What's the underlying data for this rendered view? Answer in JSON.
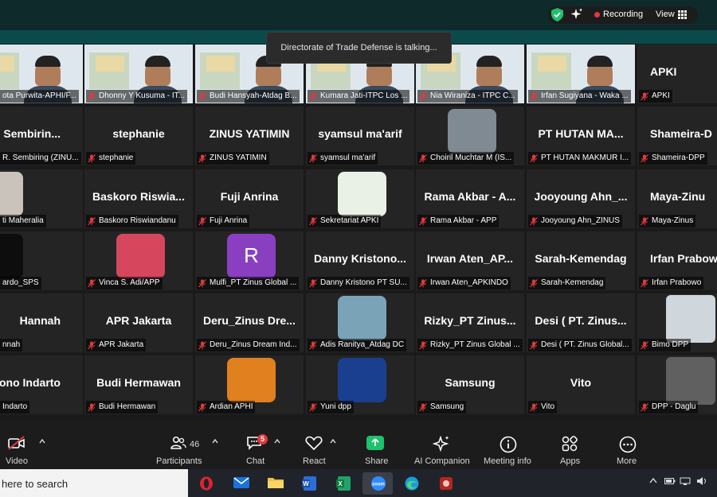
{
  "topbar": {
    "recording_label": "Recording",
    "view_label": "View",
    "icons": [
      "security-shield-icon",
      "ai-sparkle-icon",
      "recording-dot-icon",
      "grid-view-icon"
    ]
  },
  "toast": {
    "text": "Directorate of Trade Defense is talking..."
  },
  "participants": [
    {
      "label": "ota Purwita-APHI/F...",
      "big": ""
    },
    {
      "label": "Dhonny Y Kusuma - IT...",
      "big": ""
    },
    {
      "label": "Budi Hansyah-Atdag B...",
      "big": ""
    },
    {
      "label": "Kumara Jati-ITPC Los ...",
      "big": ""
    },
    {
      "label": "Nia Wiraniza - ITPC C...",
      "big": ""
    },
    {
      "label": "Irfan Sugiyana - Waka ...",
      "big": ""
    },
    {
      "label": "APKI",
      "big": "APKI"
    },
    {
      "label": "R. Sembiring (ZINU...",
      "big": "R. Sembirin..."
    },
    {
      "label": "stephanie",
      "big": "stephanie"
    },
    {
      "label": "ZINUS YATIMIN",
      "big": "ZINUS YATIMIN"
    },
    {
      "label": "syamsul ma'arif",
      "big": "syamsul ma'arif"
    },
    {
      "label": "Choiril Muchtar M (IS...",
      "big": ""
    },
    {
      "label": "PT HUTAN MAKMUR I...",
      "big": "PT HUTAN MA..."
    },
    {
      "label": "Shameira-DPP",
      "big": "Shameira-D"
    },
    {
      "label": "ti Maheralia",
      "big": ""
    },
    {
      "label": "Baskoro Riswiandanu",
      "big": "Baskoro  Riswia..."
    },
    {
      "label": "Fuji Anrina",
      "big": "Fuji  Anrina"
    },
    {
      "label": "Sekretariat APKI",
      "big": ""
    },
    {
      "label": "Rama Akbar - APP",
      "big": "Rama  Akbar  -  A..."
    },
    {
      "label": "Jooyoung Ahn_ZINUS",
      "big": "Jooyoung  Ahn_..."
    },
    {
      "label": "Maya-Zinus",
      "big": "Maya-Zinu"
    },
    {
      "label": "ardo_SPS",
      "big": ""
    },
    {
      "label": "Vinca S. Adi/APP",
      "big": ""
    },
    {
      "label": "Mulfi_PT Zinus Global ...",
      "big": ""
    },
    {
      "label": "Danny Kristono PT SU...",
      "big": "Danny  Kristono..."
    },
    {
      "label": "Irwan Aten_APKINDO",
      "big": "Irwan  Aten_AP..."
    },
    {
      "label": "Sarah-Kemendag",
      "big": "Sarah-Kemendag"
    },
    {
      "label": "Irfan Prabowo",
      "big": "Irfan  Prabow"
    },
    {
      "label": "nnah",
      "big": "Hannah"
    },
    {
      "label": "APR Jakarta",
      "big": "APR  Jakarta"
    },
    {
      "label": "Deru_Zinus Dream Ind...",
      "big": "Deru_Zinus  Dre..."
    },
    {
      "label": "Adis Ranitya_Atdag DC",
      "big": ""
    },
    {
      "label": "Rizky_PT Zinus Global ...",
      "big": "Rizky_PT  Zinus..."
    },
    {
      "label": "Desi ( PT. Zinus Global...",
      "big": "Desi  (  PT.  Zinus..."
    },
    {
      "label": "Bimo DPP",
      "big": ""
    },
    {
      "label": "Indarto",
      "big": "ono  Indarto"
    },
    {
      "label": "Budi Hermawan",
      "big": "Budi  Hermawan"
    },
    {
      "label": "Ardian APHI",
      "big": ""
    },
    {
      "label": "Yuni dpp",
      "big": ""
    },
    {
      "label": "Samsung",
      "big": "Samsung"
    },
    {
      "label": "Vito",
      "big": "Vito"
    },
    {
      "label": "DPP - Daglu",
      "big": ""
    }
  ],
  "avatar_letter": "R",
  "toolbar": {
    "video_label": "Video",
    "participants_label": "Participants",
    "participants_count": "46",
    "chat_label": "Chat",
    "chat_badge": "5",
    "react_label": "React",
    "share_label": "Share",
    "ai_label": "AI Companion",
    "meeting_info_label": "Meeting info",
    "apps_label": "Apps",
    "more_label": "More"
  },
  "taskbar": {
    "search_text": "here to search",
    "apps": [
      "opera-icon",
      "mail-icon",
      "file-explorer-icon",
      "word-icon",
      "excel-icon",
      "zoom-icon",
      "edge-icon",
      "app-icon"
    ],
    "zoom_text": "zoom"
  },
  "colors": {
    "accent_green": "#1ec26d",
    "record_red": "#e0393e",
    "toolbar_bg": "#1c1c1c",
    "grid_bg": "#1a1a1a"
  }
}
